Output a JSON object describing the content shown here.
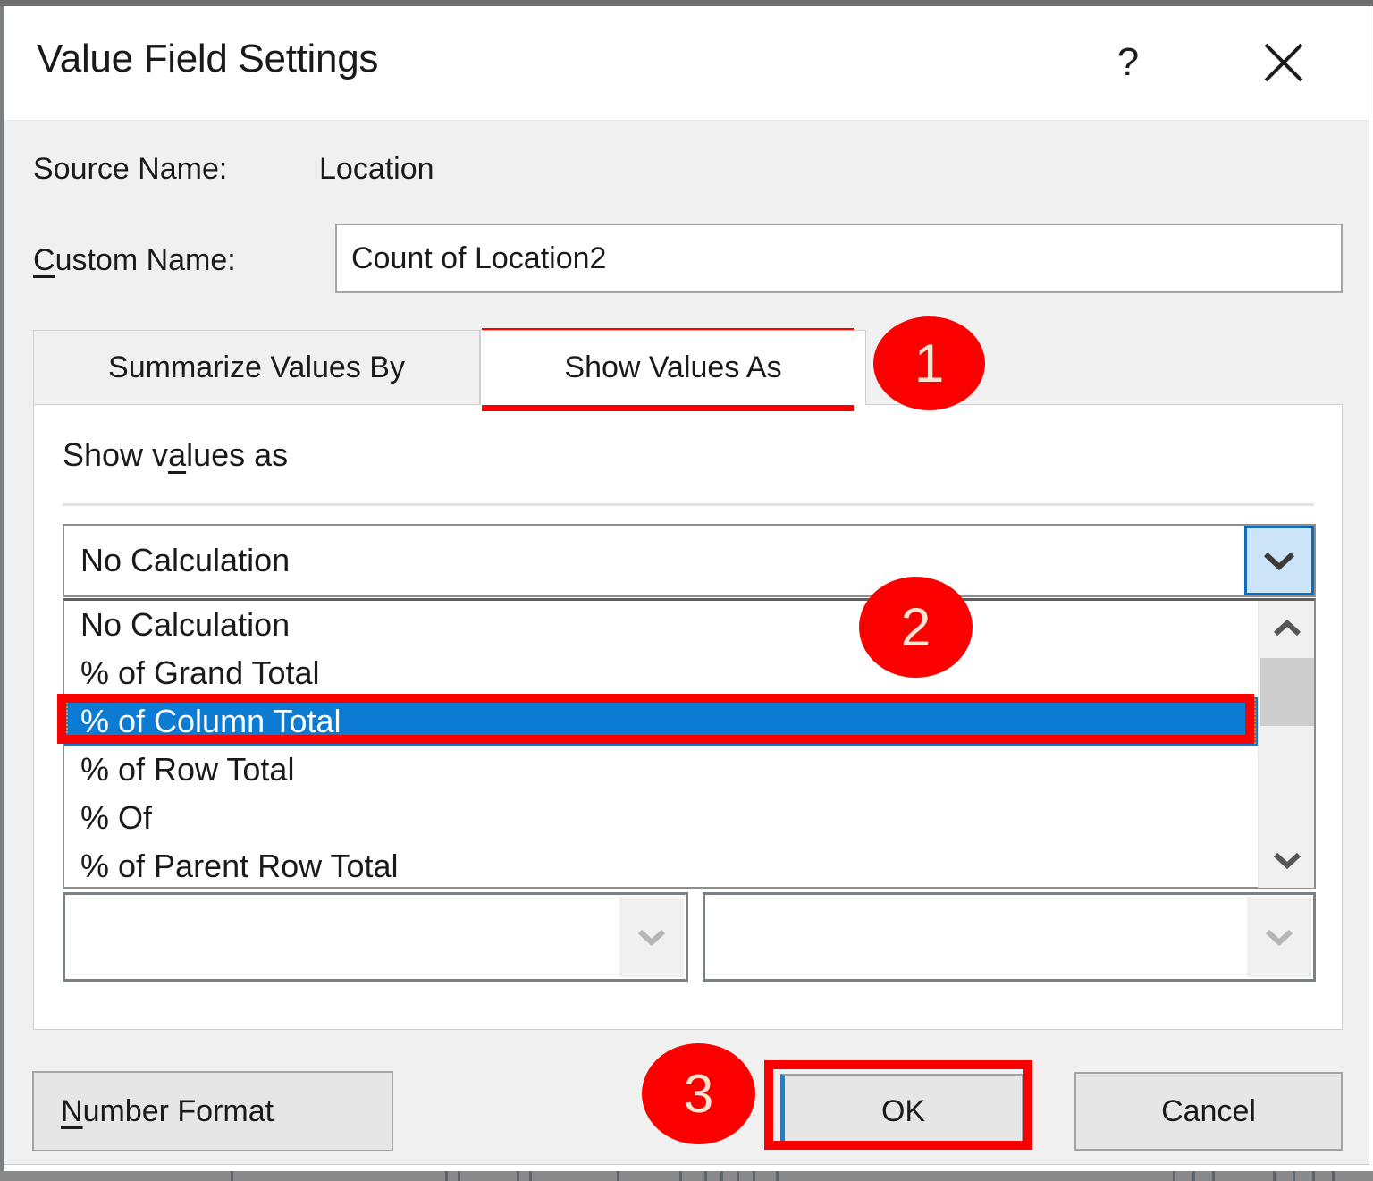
{
  "dialog": {
    "title": "Value Field Settings",
    "help_icon": "question-mark-icon",
    "help_label": "?",
    "close_icon": "close-icon"
  },
  "fields": {
    "source_name_label": "Source Name:",
    "source_name_value": "Location",
    "custom_name_label": "Custom Name:",
    "custom_name_value": "Count of Location2",
    "custom_name_placeholder": "Custom Name"
  },
  "tabs": [
    {
      "label": "Summarize Values By",
      "active": false
    },
    {
      "label": "Show Values As",
      "active": true
    }
  ],
  "panel": {
    "show_values_as_label": "Show values as",
    "combo_selected": "No Calculation",
    "combo_arrow_icon": "chevron-down-icon",
    "options": [
      "No Calculation",
      "% of Grand Total",
      "% of Column Total",
      "% of Row Total",
      "% Of",
      "% of Parent Row Total"
    ],
    "selected_option": "% of Column Total",
    "selected_option_index": 2,
    "scrollbar": {
      "up_icon": "chevron-up-icon",
      "down_icon": "chevron-down-icon"
    },
    "base_field_arrow_icon": "chevron-down-icon",
    "base_item_arrow_icon": "chevron-down-icon",
    "base_field_value": "",
    "base_item_value": ""
  },
  "footer": {
    "number_format_label": "Number Format",
    "ok_label": "OK",
    "cancel_label": "Cancel"
  },
  "annotations": {
    "step1": "1",
    "step2": "2",
    "step3": "3",
    "highlight_color": "#fc0000",
    "badge_text_color": "#fde4d2",
    "selection_color": "#0b7bd4"
  }
}
